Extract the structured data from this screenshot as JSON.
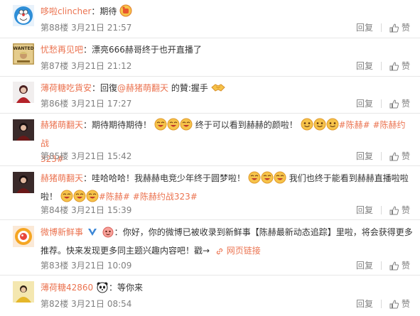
{
  "colors": {
    "accent": "#eb7350",
    "meta": "#808080",
    "text": "#333333",
    "divider": "#e7e7e7"
  },
  "actions": {
    "reply_label": "回复",
    "like_label": "赞"
  },
  "comments": [
    {
      "user": "哆啦clincher",
      "sep": "：",
      "text": "期待",
      "floor": "第88楼",
      "time": "3月21日 21:57"
    },
    {
      "user": "忧愁再见吧",
      "sep": "：",
      "text": "漂亮666赫哥终于也开直播了",
      "floor": "第87楼",
      "time": "3月21日 21:12"
    },
    {
      "user": "薄荷糖吃貨安",
      "sep": "：",
      "reply_prefix": "回復",
      "mention": "@赫猪萌翻天",
      "text": " 的贊:握手",
      "floor": "第86楼",
      "time": "3月21日 17:27"
    },
    {
      "user": "赫猪萌翻天",
      "sep": "：",
      "text": "期待期待期待！",
      "text2": " 终于可以看到赫赫的颜啦！",
      "topic1": "#陈赫#",
      "topic2": "#陈赫约战",
      "topic2b": "323#",
      "floor": "第85楼",
      "time": "3月21日 15:42"
    },
    {
      "user": "赫猪萌翻天",
      "sep": "：",
      "text": "哇哈哈哈！我赫赫电竞少年终于圆梦啦！",
      "text2": "我们也终于能看到赫赫直播啦啦",
      "text3": "啦！",
      "topic1": "#陈赫#",
      "topic2": "#陈赫约战323#",
      "floor": "第84楼",
      "time": "3月21日 15:39"
    },
    {
      "user": "微博新鲜事",
      "sep": "：",
      "text": "你好，你的微博已被收录到新鲜事【陈赫最新动态追踪】里啦，将会获得更多",
      "text2": "推荐。快来发现更多同主题兴趣内容吧！戳→",
      "link": "网页链接",
      "floor": "第83楼",
      "time": "3月21日 10:09"
    },
    {
      "user": "薄荷糖42860",
      "sep": "：",
      "text": "等你来",
      "floor": "第82楼",
      "time": "3月21日 08:54"
    }
  ]
}
